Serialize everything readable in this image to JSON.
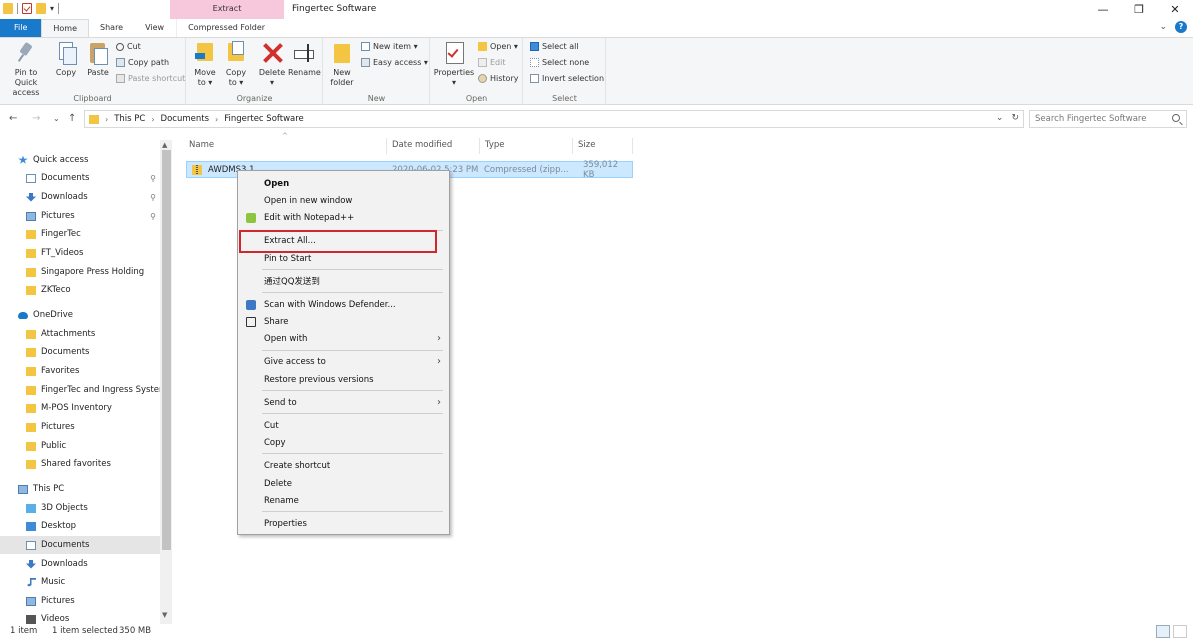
{
  "window": {
    "title": "Fingertec Software",
    "contextual_tab_group": "Extract",
    "minimize_glyph": "—",
    "maximize_glyph": "❐",
    "close_glyph": "✕"
  },
  "ribbon_tabs": [
    "File",
    "Home",
    "Share",
    "View",
    "Compressed Folder Tools"
  ],
  "ribbon": {
    "clipboard": {
      "label": "Clipboard",
      "pin_to_quick_access_line1": "Pin to Quick",
      "pin_to_quick_access_line2": "access",
      "copy": "Copy",
      "paste": "Paste",
      "cut": "Cut",
      "copy_path": "Copy path",
      "paste_shortcut": "Paste shortcut"
    },
    "organize": {
      "label": "Organize",
      "move_to_line1": "Move",
      "move_to_line2": "to ▾",
      "copy_to_line1": "Copy",
      "copy_to_line2": "to ▾",
      "delete": "Delete",
      "delete_arrow": "▾",
      "rename": "Rename"
    },
    "new": {
      "label": "New",
      "new_folder_line1": "New",
      "new_folder_line2": "folder",
      "new_item": "New item ▾",
      "easy_access": "Easy access ▾"
    },
    "open": {
      "label": "Open",
      "properties": "Properties",
      "properties_arrow": "▾",
      "open": "Open ▾",
      "edit": "Edit",
      "history": "History"
    },
    "select": {
      "label": "Select",
      "select_all": "Select all",
      "select_none": "Select none",
      "invert_selection": "Invert selection"
    }
  },
  "address": {
    "crumbs": [
      "This PC",
      "Documents",
      "Fingertec Software"
    ],
    "search_placeholder": "Search Fingertec Software"
  },
  "nav": {
    "items": [
      {
        "label": "Quick access",
        "icon": "star-icon"
      },
      {
        "label": "Documents",
        "icon": "doc-icon",
        "pinned": true
      },
      {
        "label": "Downloads",
        "icon": "download-icon",
        "pinned": true
      },
      {
        "label": "Pictures",
        "icon": "pictures-icon",
        "pinned": true
      },
      {
        "label": "FingerTec",
        "icon": "folder-icon"
      },
      {
        "label": "FT_Videos",
        "icon": "folder-icon"
      },
      {
        "label": "Singapore Press Holding",
        "icon": "folder-icon"
      },
      {
        "label": "ZKTeco",
        "icon": "folder-icon"
      },
      {
        "label": "OneDrive",
        "icon": "cloud-icon"
      },
      {
        "label": "Attachments",
        "icon": "folder-icon"
      },
      {
        "label": "Documents",
        "icon": "folder-icon"
      },
      {
        "label": "Favorites",
        "icon": "folder-icon"
      },
      {
        "label": "FingerTec and Ingress System",
        "icon": "folder-icon"
      },
      {
        "label": "M-POS Inventory",
        "icon": "folder-icon"
      },
      {
        "label": "Pictures",
        "icon": "folder-icon"
      },
      {
        "label": "Public",
        "icon": "folder-icon"
      },
      {
        "label": "Shared favorites",
        "icon": "folder-icon"
      },
      {
        "label": "This PC",
        "icon": "pc-icon"
      },
      {
        "label": "3D Objects",
        "icon": "3d-objects-icon"
      },
      {
        "label": "Desktop",
        "icon": "desktop-icon"
      },
      {
        "label": "Documents",
        "icon": "doc-icon",
        "selected": true
      },
      {
        "label": "Downloads",
        "icon": "download-icon"
      },
      {
        "label": "Music",
        "icon": "music-icon"
      },
      {
        "label": "Pictures",
        "icon": "pictures-icon"
      },
      {
        "label": "Videos",
        "icon": "videos-icon"
      }
    ]
  },
  "columns": [
    "Name",
    "Date modified",
    "Type",
    "Size"
  ],
  "file": {
    "name": "AWDMS3.1",
    "date_modified": "2020-06-02 5:23 PM",
    "type": "Compressed (zipp...",
    "size": "359,012 KB"
  },
  "context_menu": {
    "items": [
      "Open",
      "Open in new window",
      "Edit with Notepad++",
      "Extract All...",
      "Pin to Start",
      "通过QQ发送到",
      "Scan with Windows Defender...",
      "Share",
      "Open with",
      "Give access to",
      "Restore previous versions",
      "Send to",
      "Cut",
      "Copy",
      "Create shortcut",
      "Delete",
      "Rename",
      "Properties"
    ]
  },
  "status": {
    "count": "1 item",
    "selected": "1 item selected",
    "size": "350 MB"
  },
  "colors": {
    "accent": "#1979ca",
    "highlight": "#d1262c",
    "selection": "#cce8ff",
    "context_tab": "#f7c7dc"
  }
}
